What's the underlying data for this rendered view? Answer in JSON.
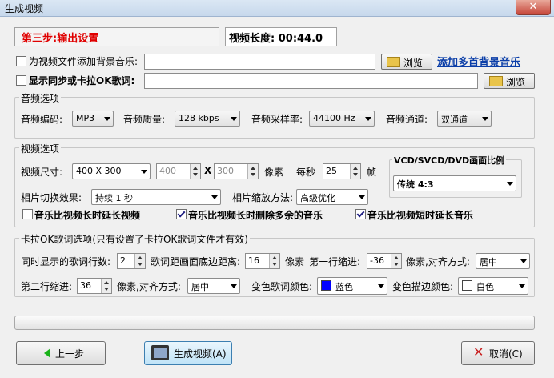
{
  "window": {
    "title": "生成视频",
    "close_glyph": "✕"
  },
  "header": {
    "step": "第三步:输出设置",
    "video_length": "视频长度: 00:44.0"
  },
  "bgmusic": {
    "checked": false,
    "label": "为视频文件添加背景音乐:",
    "value": "",
    "browse": "浏览",
    "link": "添加多首背景音乐"
  },
  "lyrics": {
    "checked": false,
    "label": "显示同步或卡拉OK歌词:",
    "value": "",
    "browse": "浏览"
  },
  "audio": {
    "group": "音频选项",
    "codec_label": "音频编码:",
    "codec": "MP3",
    "quality_label": "音频质量:",
    "quality": "128 kbps",
    "rate_label": "音频采样率:",
    "rate": "44100 Hz",
    "channel_label": "音频通道:",
    "channel": "双通道"
  },
  "video": {
    "group": "视频选项",
    "size_label": "视频尺寸:",
    "size": "400 X 300",
    "width": "400",
    "x_sep": "X",
    "height": "300",
    "px_unit": "像素",
    "fps_label": "每秒",
    "fps": "25",
    "fps_unit": "帧",
    "transition_label": "相片切换效果:",
    "transition": "持续 1 秒",
    "zoom_label": "相片缩放方法:",
    "zoom": "高级优化",
    "ratio_group": "VCD/SVCD/DVD画面比例",
    "ratio": "传统 4:3",
    "opt1": {
      "checked": false,
      "label": "音乐比视频长时延长视频"
    },
    "opt2": {
      "checked": true,
      "label": "音乐比视频长时删除多余的音乐"
    },
    "opt3": {
      "checked": true,
      "label": "音乐比视频短时延长音乐"
    }
  },
  "karaoke": {
    "group": "卡拉OK歌词选项(只有设置了卡拉OK歌词文件才有效)",
    "lines_label": "同时显示的歌词行数:",
    "lines": "2",
    "bottom_label": "歌词距画面底边距离:",
    "bottom": "16",
    "bottom_unit": "像素",
    "indent1_label": "第一行缩进:",
    "indent1": "-36",
    "align1_label": "像素,对齐方式:",
    "align1": "居中",
    "indent2_label": "第二行缩进:",
    "indent2": "36",
    "align2_label": "像素,对齐方式:",
    "align2": "居中",
    "color_label": "变色歌词颜色:",
    "color": "蓝色",
    "color_hex": "#0000ff",
    "outline_label": "变色描边颜色:",
    "outline": "白色",
    "outline_hex": "#ffffff"
  },
  "footer": {
    "prev": "上一步",
    "generate": "生成视频(A)",
    "cancel": "取消(C)"
  }
}
